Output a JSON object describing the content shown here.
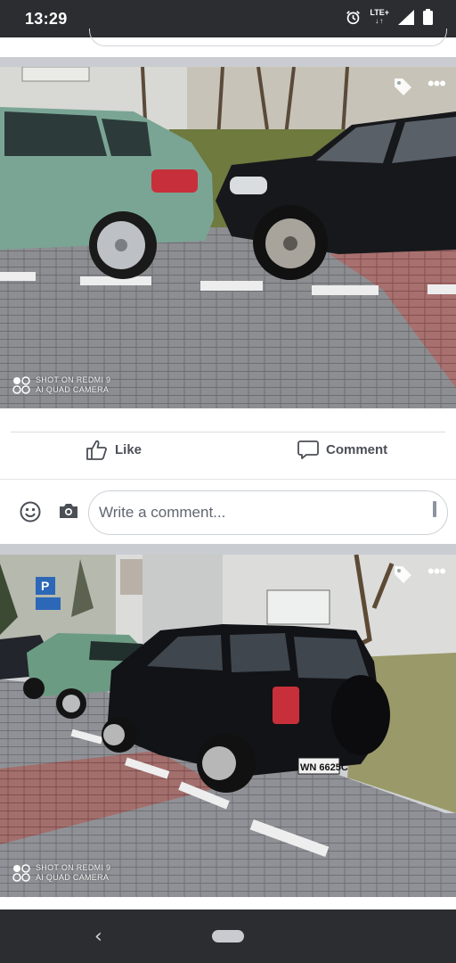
{
  "status_bar": {
    "time": "13:29",
    "network_label": "LTE+",
    "network_arrows": "↓↑",
    "icons": [
      "alarm-icon",
      "signal-icon",
      "battery-icon"
    ]
  },
  "posts": [
    {
      "photo_description_icon": "tag-icon",
      "watermark": {
        "line1": "SHOT ON REDMI 9",
        "line2": "AI QUAD CAMERA"
      },
      "actions": {
        "like_label": "Like",
        "comment_label": "Comment"
      },
      "comment": {
        "placeholder": "Write a comment..."
      }
    },
    {
      "photo_description_icon": "tag-icon",
      "watermark": {
        "line1": "SHOT ON REDMI 9",
        "line2": "AI QUAD CAMERA"
      },
      "plate_text": "WN 6625C"
    }
  ],
  "colors": {
    "status_bar": "#2b2d30",
    "feed_background": "#c9ccd1",
    "text_secondary": "#4b4f56",
    "nav_bar": "#2b2d30"
  }
}
